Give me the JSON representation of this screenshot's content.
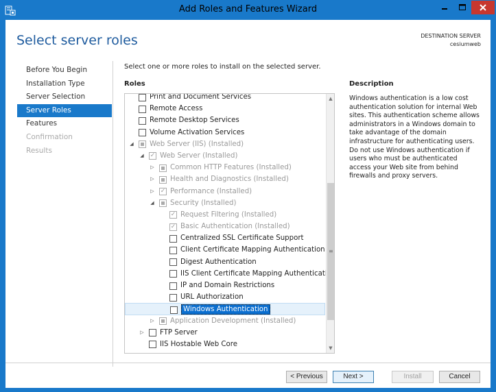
{
  "window": {
    "title": "Add Roles and Features Wizard"
  },
  "header": {
    "page_title": "Select server roles",
    "destination_label": "DESTINATION SERVER",
    "destination_name": "cesiumweb"
  },
  "nav": {
    "items": [
      {
        "label": "Before You Begin",
        "state": "normal"
      },
      {
        "label": "Installation Type",
        "state": "normal"
      },
      {
        "label": "Server Selection",
        "state": "normal"
      },
      {
        "label": "Server Roles",
        "state": "active"
      },
      {
        "label": "Features",
        "state": "normal"
      },
      {
        "label": "Confirmation",
        "state": "disabled"
      },
      {
        "label": "Results",
        "state": "disabled"
      }
    ]
  },
  "main": {
    "instructions": "Select one or more roles to install on the selected server.",
    "roles_label": "Roles",
    "description_label": "Description",
    "description_text": "Windows authentication is a low cost authentication solution for internal Web sites. This authentication scheme allows administrators in a Windows domain to take advantage of the domain infrastructure for authenticating users. Do not use Windows authentication if users who must be authenticated access your Web site from behind firewalls and proxy servers."
  },
  "roles_tree": [
    {
      "label": "Print and Document Services",
      "level": 0,
      "expander": "",
      "check": "none",
      "greyed": false
    },
    {
      "label": "Remote Access",
      "level": 0,
      "expander": "",
      "check": "none",
      "greyed": false
    },
    {
      "label": "Remote Desktop Services",
      "level": 0,
      "expander": "",
      "check": "none",
      "greyed": false
    },
    {
      "label": "Volume Activation Services",
      "level": 0,
      "expander": "",
      "check": "none",
      "greyed": false
    },
    {
      "label": "Web Server (IIS) (Installed)",
      "level": 0,
      "expander": "open",
      "check": "partial",
      "greyed": true
    },
    {
      "label": "Web Server (Installed)",
      "level": 1,
      "expander": "open",
      "check": "checked",
      "greyed": true
    },
    {
      "label": "Common HTTP Features (Installed)",
      "level": 2,
      "expander": "closed",
      "check": "partial",
      "greyed": true
    },
    {
      "label": "Health and Diagnostics (Installed)",
      "level": 2,
      "expander": "closed",
      "check": "partial",
      "greyed": true
    },
    {
      "label": "Performance (Installed)",
      "level": 2,
      "expander": "closed",
      "check": "checked",
      "greyed": true
    },
    {
      "label": "Security (Installed)",
      "level": 2,
      "expander": "open",
      "check": "partial",
      "greyed": true
    },
    {
      "label": "Request Filtering (Installed)",
      "level": 3,
      "expander": "",
      "check": "checked",
      "greyed": true
    },
    {
      "label": "Basic Authentication (Installed)",
      "level": 3,
      "expander": "",
      "check": "checked",
      "greyed": true
    },
    {
      "label": "Centralized SSL Certificate Support",
      "level": 3,
      "expander": "",
      "check": "none",
      "greyed": false
    },
    {
      "label": "Client Certificate Mapping Authentication",
      "level": 3,
      "expander": "",
      "check": "none",
      "greyed": false
    },
    {
      "label": "Digest Authentication",
      "level": 3,
      "expander": "",
      "check": "none",
      "greyed": false
    },
    {
      "label": "IIS Client Certificate Mapping Authentication",
      "level": 3,
      "expander": "",
      "check": "none",
      "greyed": false
    },
    {
      "label": "IP and Domain Restrictions",
      "level": 3,
      "expander": "",
      "check": "none",
      "greyed": false
    },
    {
      "label": "URL Authorization",
      "level": 3,
      "expander": "",
      "check": "none",
      "greyed": false
    },
    {
      "label": "Windows Authentication",
      "level": 3,
      "expander": "",
      "check": "none",
      "greyed": false,
      "selected": true
    },
    {
      "label": "Application Development (Installed)",
      "level": 2,
      "expander": "closed",
      "check": "partial",
      "greyed": true
    },
    {
      "label": "FTP Server",
      "level": 1,
      "expander": "closed",
      "check": "none",
      "greyed": false
    },
    {
      "label": "IIS Hostable Web Core",
      "level": 1,
      "expander": "",
      "check": "none",
      "greyed": false
    }
  ],
  "buttons": {
    "previous": "< Previous",
    "next": "Next >",
    "install": "Install",
    "cancel": "Cancel"
  },
  "icons": {
    "minimize": "minimize-icon",
    "maximize": "maximize-icon",
    "close": "close-icon",
    "app": "server-manager-icon"
  }
}
